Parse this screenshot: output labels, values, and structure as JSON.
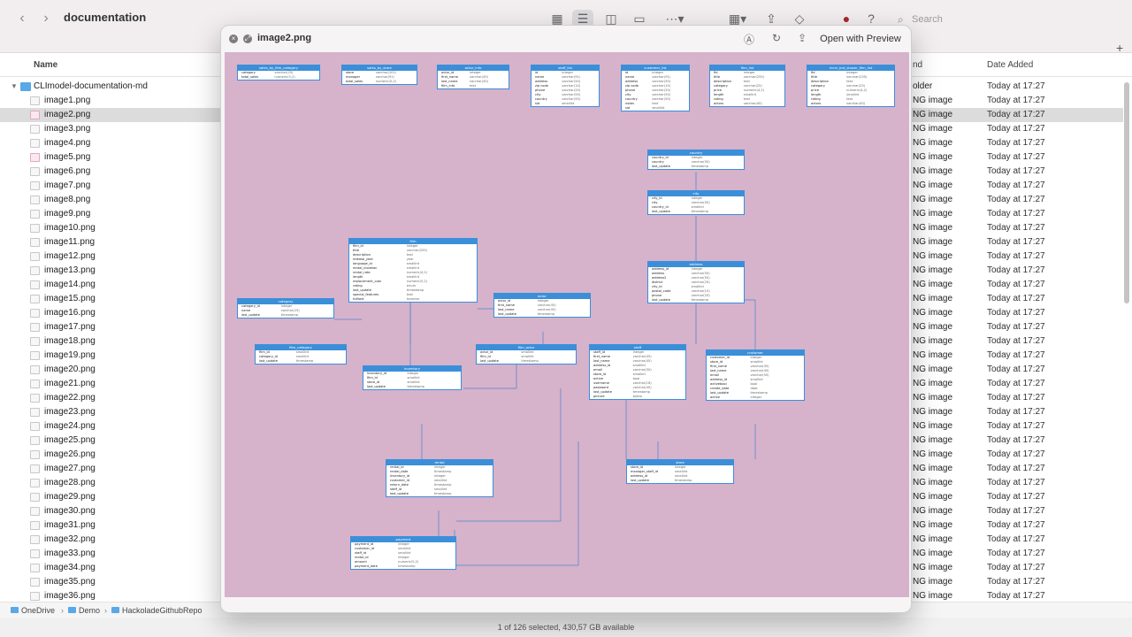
{
  "toolbar": {
    "back_icon": "chevron-left-icon",
    "forward_icon": "chevron-right-icon",
    "title": "documentation",
    "search_placeholder": "Search"
  },
  "columns": {
    "name": "Name",
    "kind": "nd",
    "date": "Date Added"
  },
  "folder": {
    "name": "CLImodel-documentation-md",
    "kind": "older",
    "date": "Today at 17:27"
  },
  "files": [
    {
      "name": "image1.png",
      "kind": "NG image",
      "date": "Today at 17:27"
    },
    {
      "name": "image2.png",
      "kind": "NG image",
      "date": "Today at 17:27",
      "selected": true
    },
    {
      "name": "image3.png",
      "kind": "NG image",
      "date": "Today at 17:27"
    },
    {
      "name": "image4.png",
      "kind": "NG image",
      "date": "Today at 17:27"
    },
    {
      "name": "image5.png",
      "kind": "NG image",
      "date": "Today at 17:27"
    },
    {
      "name": "image6.png",
      "kind": "NG image",
      "date": "Today at 17:27"
    },
    {
      "name": "image7.png",
      "kind": "NG image",
      "date": "Today at 17:27"
    },
    {
      "name": "image8.png",
      "kind": "NG image",
      "date": "Today at 17:27"
    },
    {
      "name": "image9.png",
      "kind": "NG image",
      "date": "Today at 17:27"
    },
    {
      "name": "image10.png",
      "kind": "NG image",
      "date": "Today at 17:27"
    },
    {
      "name": "image11.png",
      "kind": "NG image",
      "date": "Today at 17:27"
    },
    {
      "name": "image12.png",
      "kind": "NG image",
      "date": "Today at 17:27"
    },
    {
      "name": "image13.png",
      "kind": "NG image",
      "date": "Today at 17:27"
    },
    {
      "name": "image14.png",
      "kind": "NG image",
      "date": "Today at 17:27"
    },
    {
      "name": "image15.png",
      "kind": "NG image",
      "date": "Today at 17:27"
    },
    {
      "name": "image16.png",
      "kind": "NG image",
      "date": "Today at 17:27"
    },
    {
      "name": "image17.png",
      "kind": "NG image",
      "date": "Today at 17:27"
    },
    {
      "name": "image18.png",
      "kind": "NG image",
      "date": "Today at 17:27"
    },
    {
      "name": "image19.png",
      "kind": "NG image",
      "date": "Today at 17:27"
    },
    {
      "name": "image20.png",
      "kind": "NG image",
      "date": "Today at 17:27"
    },
    {
      "name": "image21.png",
      "kind": "NG image",
      "date": "Today at 17:27"
    },
    {
      "name": "image22.png",
      "kind": "NG image",
      "date": "Today at 17:27"
    },
    {
      "name": "image23.png",
      "kind": "NG image",
      "date": "Today at 17:27"
    },
    {
      "name": "image24.png",
      "kind": "NG image",
      "date": "Today at 17:27"
    },
    {
      "name": "image25.png",
      "kind": "NG image",
      "date": "Today at 17:27"
    },
    {
      "name": "image26.png",
      "kind": "NG image",
      "date": "Today at 17:27"
    },
    {
      "name": "image27.png",
      "kind": "NG image",
      "date": "Today at 17:27"
    },
    {
      "name": "image28.png",
      "kind": "NG image",
      "date": "Today at 17:27"
    },
    {
      "name": "image29.png",
      "kind": "NG image",
      "date": "Today at 17:27"
    },
    {
      "name": "image30.png",
      "kind": "NG image",
      "date": "Today at 17:27"
    },
    {
      "name": "image31.png",
      "kind": "NG image",
      "date": "Today at 17:27"
    },
    {
      "name": "image32.png",
      "kind": "NG image",
      "date": "Today at 17:27"
    },
    {
      "name": "image33.png",
      "kind": "NG image",
      "date": "Today at 17:27"
    },
    {
      "name": "image34.png",
      "kind": "NG image",
      "date": "Today at 17:27"
    },
    {
      "name": "image35.png",
      "kind": "NG image",
      "date": "Today at 17:27"
    },
    {
      "name": "image36.png",
      "kind": "NG image",
      "date": "Today at 17:27"
    }
  ],
  "pathbar": [
    "OneDrive",
    "Demo",
    "HackoladeGithubRepo"
  ],
  "status": "1 of 126 selected, 430,57 GB available",
  "quicklook": {
    "title": "image2.png",
    "open_label": "Open with Preview",
    "diagram": {
      "entities": [
        {
          "name": "sales_by_film_category",
          "rows": [
            [
              "category",
              "varchar(25)"
            ],
            [
              "total_sales",
              "numeric(5,2)"
            ]
          ]
        },
        {
          "name": "sales_by_store",
          "rows": [
            [
              "store",
              "varchar(101)"
            ],
            [
              "manager",
              "varchar(91)"
            ],
            [
              "total_sales",
              "numeric(5,2)"
            ]
          ]
        },
        {
          "name": "actor_info",
          "rows": [
            [
              "actor_id",
              "integer"
            ],
            [
              "first_name",
              "varchar(45)"
            ],
            [
              "last_name",
              "varchar(45)"
            ],
            [
              "film_info",
              "text"
            ]
          ]
        },
        {
          "name": "staff_list",
          "rows": [
            [
              "id",
              "integer"
            ],
            [
              "name",
              "varchar(91)"
            ],
            [
              "address",
              "varchar(50)"
            ],
            [
              "zip code",
              "varchar(10)"
            ],
            [
              "phone",
              "varchar(20)"
            ],
            [
              "city",
              "varchar(50)"
            ],
            [
              "country",
              "varchar(50)"
            ],
            [
              "sid",
              "smallint"
            ]
          ]
        },
        {
          "name": "customer_list",
          "rows": [
            [
              "id",
              "integer"
            ],
            [
              "name",
              "varchar(91)"
            ],
            [
              "address",
              "varchar(50)"
            ],
            [
              "zip code",
              "varchar(10)"
            ],
            [
              "phone",
              "varchar(20)"
            ],
            [
              "city",
              "varchar(50)"
            ],
            [
              "country",
              "varchar(50)"
            ],
            [
              "notes",
              "text"
            ],
            [
              "sid",
              "smallint"
            ]
          ]
        },
        {
          "name": "film_list",
          "rows": [
            [
              "fid",
              "integer"
            ],
            [
              "title",
              "varchar(255)"
            ],
            [
              "description",
              "text"
            ],
            [
              "category",
              "varchar(25)"
            ],
            [
              "price",
              "numeric(4,2)"
            ],
            [
              "length",
              "smallint"
            ],
            [
              "rating",
              "text"
            ],
            [
              "actors",
              "varchar(40)"
            ]
          ]
        },
        {
          "name": "nicer_but_slower_film_list",
          "rows": [
            [
              "fid",
              "integer"
            ],
            [
              "title",
              "varchar(255)"
            ],
            [
              "description",
              "text"
            ],
            [
              "category",
              "varchar(25)"
            ],
            [
              "price",
              "numeric(4,2)"
            ],
            [
              "length",
              "smallint"
            ],
            [
              "rating",
              "text"
            ],
            [
              "actors",
              "varchar(40)"
            ]
          ]
        },
        {
          "name": "country",
          "rows": [
            [
              "country_id",
              "integer"
            ],
            [
              "country",
              "varchar(50)"
            ],
            [
              "last_update",
              "timestamp"
            ]
          ]
        },
        {
          "name": "city",
          "rows": [
            [
              "city_id",
              "integer"
            ],
            [
              "city",
              "varchar(50)"
            ],
            [
              "country_id",
              "smallint"
            ],
            [
              "last_update",
              "timestamp"
            ]
          ]
        },
        {
          "name": "film",
          "rows": [
            [
              "film_id",
              "integer"
            ],
            [
              "title",
              "varchar(255)"
            ],
            [
              "description",
              "text"
            ],
            [
              "release_year",
              "year"
            ],
            [
              "language_id",
              "smallint"
            ],
            [
              "rental_duration",
              "smallint"
            ],
            [
              "rental_rate",
              "numeric(4,2)"
            ],
            [
              "length",
              "smallint"
            ],
            [
              "replacement_cost",
              "numeric(5,2)"
            ],
            [
              "rating",
              "enum"
            ],
            [
              "last_update",
              "timestamp"
            ],
            [
              "special_features",
              "text"
            ],
            [
              "fulltext",
              "tsvector"
            ]
          ]
        },
        {
          "name": "address",
          "rows": [
            [
              "address_id",
              "integer"
            ],
            [
              "address",
              "varchar(50)"
            ],
            [
              "address2",
              "varchar(50)"
            ],
            [
              "district",
              "varchar(20)"
            ],
            [
              "city_id",
              "smallint"
            ],
            [
              "postal_code",
              "varchar(10)"
            ],
            [
              "phone",
              "varchar(20)"
            ],
            [
              "last_update",
              "timestamp"
            ]
          ]
        },
        {
          "name": "category",
          "rows": [
            [
              "category_id",
              "integer"
            ],
            [
              "name",
              "varchar(25)"
            ],
            [
              "last_update",
              "timestamp"
            ]
          ]
        },
        {
          "name": "actor",
          "rows": [
            [
              "actor_id",
              "integer"
            ],
            [
              "first_name",
              "varchar(45)"
            ],
            [
              "last_name",
              "varchar(45)"
            ],
            [
              "last_update",
              "timestamp"
            ]
          ]
        },
        {
          "name": "film_category",
          "rows": [
            [
              "film_id",
              "smallint"
            ],
            [
              "category_id",
              "smallint"
            ],
            [
              "last_update",
              "timestamp"
            ]
          ]
        },
        {
          "name": "film_actor",
          "rows": [
            [
              "actor_id",
              "smallint"
            ],
            [
              "film_id",
              "smallint"
            ],
            [
              "last_update",
              "timestamp"
            ]
          ]
        },
        {
          "name": "inventory",
          "rows": [
            [
              "inventory_id",
              "integer"
            ],
            [
              "film_id",
              "smallint"
            ],
            [
              "store_id",
              "smallint"
            ],
            [
              "last_update",
              "timestamp"
            ]
          ]
        },
        {
          "name": "staff",
          "rows": [
            [
              "staff_id",
              "integer"
            ],
            [
              "first_name",
              "varchar(45)"
            ],
            [
              "last_name",
              "varchar(45)"
            ],
            [
              "address_id",
              "smallint"
            ],
            [
              "email",
              "varchar(50)"
            ],
            [
              "store_id",
              "smallint"
            ],
            [
              "active",
              "bool"
            ],
            [
              "username",
              "varchar(16)"
            ],
            [
              "password",
              "varchar(40)"
            ],
            [
              "last_update",
              "timestamp"
            ],
            [
              "picture",
              "bytea"
            ]
          ]
        },
        {
          "name": "customer",
          "rows": [
            [
              "customer_id",
              "integer"
            ],
            [
              "store_id",
              "smallint"
            ],
            [
              "first_name",
              "varchar(45)"
            ],
            [
              "last_name",
              "varchar(45)"
            ],
            [
              "email",
              "varchar(50)"
            ],
            [
              "address_id",
              "smallint"
            ],
            [
              "activebool",
              "bool"
            ],
            [
              "create_date",
              "date"
            ],
            [
              "last_update",
              "timestamp"
            ],
            [
              "active",
              "integer"
            ]
          ]
        },
        {
          "name": "rental",
          "rows": [
            [
              "rental_id",
              "integer"
            ],
            [
              "rental_date",
              "timestamp"
            ],
            [
              "inventory_id",
              "integer"
            ],
            [
              "customer_id",
              "smallint"
            ],
            [
              "return_date",
              "timestamp"
            ],
            [
              "staff_id",
              "smallint"
            ],
            [
              "last_update",
              "timestamp"
            ]
          ]
        },
        {
          "name": "store",
          "rows": [
            [
              "store_id",
              "integer"
            ],
            [
              "manager_staff_id",
              "smallint"
            ],
            [
              "address_id",
              "smallint"
            ],
            [
              "last_update",
              "timestamp"
            ]
          ]
        },
        {
          "name": "payment",
          "rows": [
            [
              "payment_id",
              "integer"
            ],
            [
              "customer_id",
              "smallint"
            ],
            [
              "staff_id",
              "smallint"
            ],
            [
              "rental_id",
              "integer"
            ],
            [
              "amount",
              "numeric(5,2)"
            ],
            [
              "payment_date",
              "timestamp"
            ]
          ]
        }
      ]
    }
  }
}
